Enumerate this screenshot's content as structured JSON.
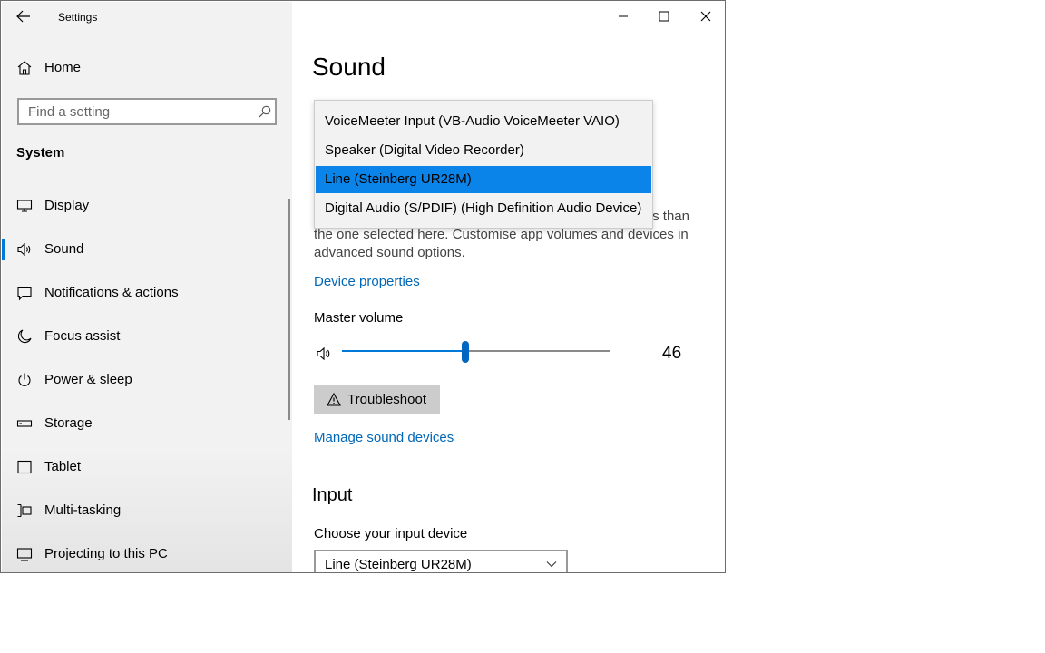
{
  "window": {
    "title": "Settings",
    "controls": [
      "minimize",
      "maximize",
      "close"
    ]
  },
  "sidebar": {
    "home_label": "Home",
    "search_placeholder": "Find a setting",
    "section_title": "System",
    "items": [
      {
        "label": "Display",
        "icon": "monitor-icon",
        "selected": false
      },
      {
        "label": "Sound",
        "icon": "speaker-icon",
        "selected": true
      },
      {
        "label": "Notifications & actions",
        "icon": "notification-icon",
        "selected": false
      },
      {
        "label": "Focus assist",
        "icon": "moon-icon",
        "selected": false
      },
      {
        "label": "Power & sleep",
        "icon": "power-icon",
        "selected": false
      },
      {
        "label": "Storage",
        "icon": "storage-icon",
        "selected": false
      },
      {
        "label": "Tablet",
        "icon": "tablet-icon",
        "selected": false
      },
      {
        "label": "Multi-tasking",
        "icon": "multitasking-icon",
        "selected": false
      },
      {
        "label": "Projecting to this PC",
        "icon": "projector-icon",
        "selected": false
      }
    ]
  },
  "main": {
    "page_title": "Sound",
    "output_dropdown": {
      "options": [
        "VoiceMeeter Input (VB-Audio VoiceMeeter VAIO)",
        "Speaker (Digital Video Recorder)",
        "Line (Steinberg UR28M)",
        "Digital Audio (S/PDIF) (High Definition Audio Device)"
      ],
      "selected_index": 2
    },
    "description_line1_tail": "es than",
    "description_line2": "the one selected here. Customise app volumes and devices in",
    "description_line3": "advanced sound options.",
    "device_properties_link": "Device properties",
    "master_volume_label": "Master volume",
    "master_volume_value": "46",
    "volume_fraction": 0.46,
    "troubleshoot_label": "Troubleshoot",
    "manage_devices_link": "Manage sound devices",
    "input_section_title": "Input",
    "input_device_label": "Choose your input device",
    "input_device_value": "Line (Steinberg UR28M)"
  },
  "colors": {
    "accent": "#0078d7",
    "link": "#0067b8",
    "selected_option": "#0a84e8"
  }
}
